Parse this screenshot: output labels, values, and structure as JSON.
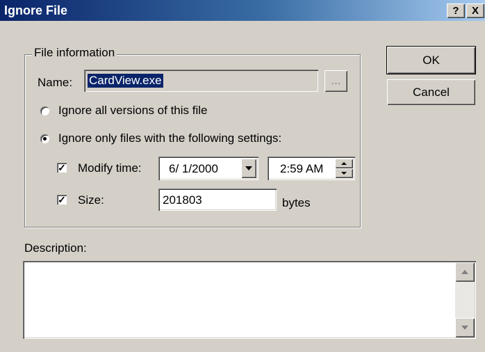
{
  "window": {
    "title": "Ignore File",
    "help_label": "?",
    "close_label": "X"
  },
  "file_info": {
    "group_label": "File information",
    "name_label": "Name:",
    "name_value": "CardView.exe",
    "browse_label": "...",
    "radio_all_label": "Ignore all versions of this file",
    "radio_only_label": "Ignore only files with the following settings:",
    "selected_option": "only",
    "modify_time": {
      "label": "Modify time:",
      "checked": true,
      "date_value": "6/ 1/2000",
      "time_value": "2:59 AM"
    },
    "size": {
      "label": "Size:",
      "checked": true,
      "value": "201803",
      "unit_label": "bytes"
    }
  },
  "buttons": {
    "ok_label": "OK",
    "cancel_label": "Cancel"
  },
  "description": {
    "label": "Description:",
    "value": ""
  },
  "colors": {
    "dialog_bg": "#d4d0c8",
    "titlebar_start": "#0a246a",
    "titlebar_end": "#a6caf0",
    "selection": "#0a246a"
  }
}
